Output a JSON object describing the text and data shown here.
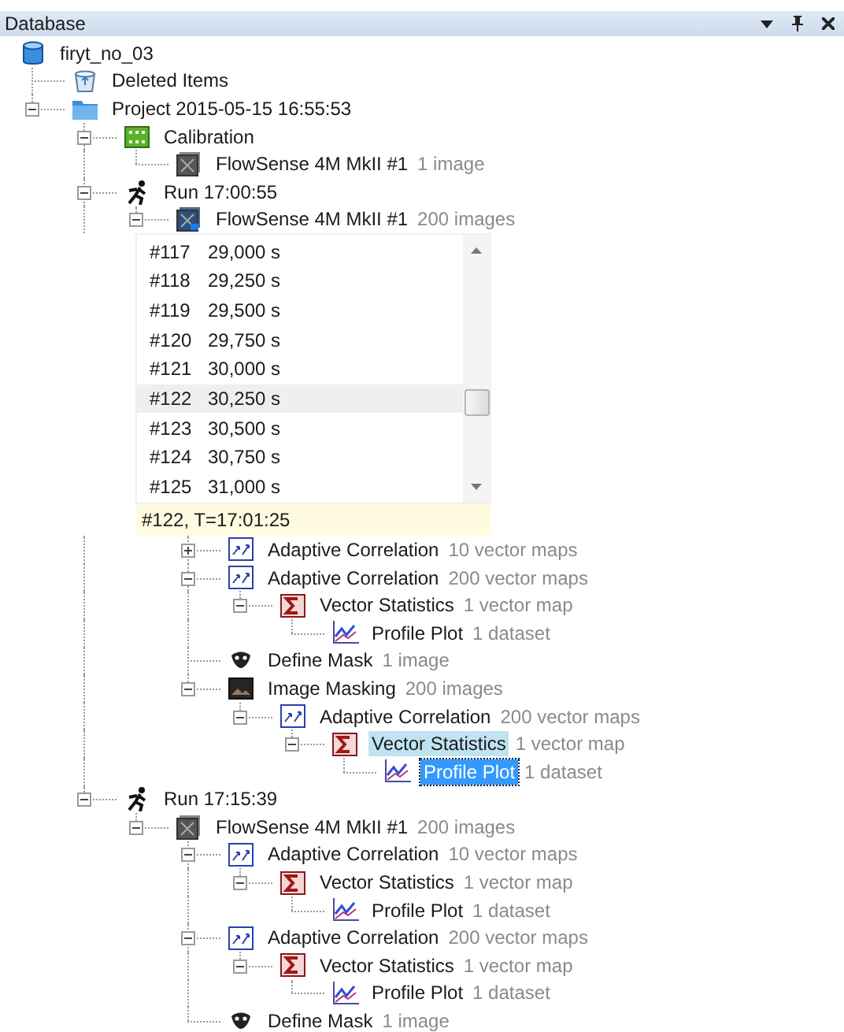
{
  "panel": {
    "title": "Database"
  },
  "tree": {
    "label": "firyt_no_03",
    "kind": "database",
    "selected": false,
    "hovered": false,
    "children": [
      {
        "label": "Deleted Items",
        "kind": "trash",
        "selected": false,
        "hovered": false
      },
      {
        "label": "Project 2015-05-15 16:55:53",
        "kind": "folder",
        "expanded": true,
        "selected": false,
        "hovered": false,
        "children": [
          {
            "label": "Calibration",
            "kind": "calibration",
            "expanded": true,
            "selected": false,
            "hovered": false,
            "children": [
              {
                "label": "FlowSense 4M MkII #1",
                "detail": "1 image",
                "kind": "camera",
                "selected": false,
                "hovered": false
              }
            ]
          },
          {
            "label": "Run 17:00:55",
            "kind": "run",
            "expanded": true,
            "selected": false,
            "hovered": false,
            "children": [
              {
                "label": "FlowSense 4M MkII #1",
                "detail": "200 images",
                "kind": "camera-active",
                "expanded": true,
                "selected": false,
                "hovered": false,
                "image_list": {
                  "items": [
                    {
                      "number": "#117",
                      "time": "29,000 s",
                      "selected": false
                    },
                    {
                      "number": "#118",
                      "time": "29,250 s",
                      "selected": false
                    },
                    {
                      "number": "#119",
                      "time": "29,500 s",
                      "selected": false
                    },
                    {
                      "number": "#120",
                      "time": "29,750 s",
                      "selected": false
                    },
                    {
                      "number": "#121",
                      "time": "30,000 s",
                      "selected": false
                    },
                    {
                      "number": "#122",
                      "time": "30,250 s",
                      "selected": true
                    },
                    {
                      "number": "#123",
                      "time": "30,500 s",
                      "selected": false
                    },
                    {
                      "number": "#124",
                      "time": "30,750 s",
                      "selected": false
                    },
                    {
                      "number": "#125",
                      "time": "31,000 s",
                      "selected": false
                    }
                  ],
                  "tooltip": "#122, T=17:01:25"
                },
                "children": [
                  {
                    "label": "Adaptive Correlation",
                    "detail": "10 vector maps",
                    "kind": "vector",
                    "expanded": false,
                    "selected": false,
                    "hovered": false
                  },
                  {
                    "label": "Adaptive Correlation",
                    "detail": "200 vector maps",
                    "kind": "vector",
                    "expanded": true,
                    "selected": false,
                    "hovered": false,
                    "children": [
                      {
                        "label": "Vector Statistics",
                        "detail": "1 vector map",
                        "kind": "sigma",
                        "expanded": true,
                        "selected": false,
                        "hovered": false,
                        "children": [
                          {
                            "label": "Profile Plot",
                            "detail": "1 dataset",
                            "kind": "plot",
                            "selected": false,
                            "hovered": false
                          }
                        ]
                      }
                    ]
                  },
                  {
                    "label": "Define Mask",
                    "detail": "1 image",
                    "kind": "mask",
                    "selected": false,
                    "hovered": false
                  },
                  {
                    "label": "Image Masking",
                    "detail": "200 images",
                    "kind": "masking",
                    "expanded": true,
                    "selected": false,
                    "hovered": false,
                    "children": [
                      {
                        "label": "Adaptive Correlation",
                        "detail": "200 vector maps",
                        "kind": "vector",
                        "expanded": true,
                        "selected": false,
                        "hovered": false,
                        "children": [
                          {
                            "label": "Vector Statistics",
                            "detail": "1 vector map",
                            "kind": "sigma",
                            "expanded": true,
                            "selected": false,
                            "hovered": true,
                            "children": [
                              {
                                "label": "Profile Plot",
                                "detail": "1 dataset",
                                "kind": "plot",
                                "selected": true,
                                "hovered": false
                              }
                            ]
                          }
                        ]
                      }
                    ]
                  }
                ]
              }
            ]
          },
          {
            "label": "Run 17:15:39",
            "kind": "run",
            "expanded": true,
            "selected": false,
            "hovered": false,
            "children": [
              {
                "label": "FlowSense 4M MkII #1",
                "detail": "200 images",
                "kind": "camera",
                "expanded": true,
                "selected": false,
                "hovered": false,
                "children": [
                  {
                    "label": "Adaptive Correlation",
                    "detail": "10 vector maps",
                    "kind": "vector",
                    "expanded": true,
                    "selected": false,
                    "hovered": false,
                    "children": [
                      {
                        "label": "Vector Statistics",
                        "detail": "1 vector map",
                        "kind": "sigma",
                        "expanded": true,
                        "selected": false,
                        "hovered": false,
                        "children": [
                          {
                            "label": "Profile Plot",
                            "detail": "1 dataset",
                            "kind": "plot",
                            "selected": false,
                            "hovered": false
                          }
                        ]
                      }
                    ]
                  },
                  {
                    "label": "Adaptive Correlation",
                    "detail": "200 vector maps",
                    "kind": "vector",
                    "expanded": true,
                    "selected": false,
                    "hovered": false,
                    "children": [
                      {
                        "label": "Vector Statistics",
                        "detail": "1 vector map",
                        "kind": "sigma",
                        "expanded": true,
                        "selected": false,
                        "hovered": false,
                        "children": [
                          {
                            "label": "Profile Plot",
                            "detail": "1 dataset",
                            "kind": "plot",
                            "selected": false,
                            "hovered": false
                          }
                        ]
                      }
                    ]
                  },
                  {
                    "label": "Define Mask",
                    "detail": "1 image",
                    "kind": "mask",
                    "selected": false,
                    "hovered": false
                  }
                ]
              }
            ]
          }
        ]
      }
    ]
  }
}
